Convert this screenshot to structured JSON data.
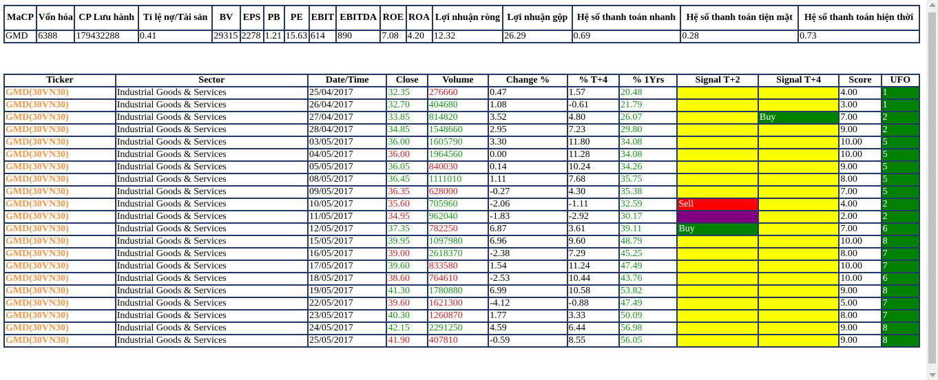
{
  "summary": {
    "headers": [
      "MaCP",
      "Vốn hóa",
      "CP Lưu hành",
      "Tỉ lệ nợ/Tài sản",
      "BV",
      "EPS",
      "PB",
      "PE",
      "EBIT",
      "EBITDA",
      "ROE",
      "ROA",
      "Lợi nhuận ròng",
      "Lợi nhuận gộp",
      "Hệ số thanh toán nhanh",
      "Hệ số thanh toán tiện mặt",
      "Hệ số thanh toán hiện thời"
    ],
    "row": [
      "GMD",
      "6388",
      "179432288",
      "0.41",
      "29315",
      "2278",
      "1.21",
      "15.63",
      "614",
      "890",
      "7.08",
      "4.20",
      "12.32",
      "26.29",
      "0.69",
      "0.28",
      "0.73"
    ]
  },
  "signals": {
    "headers": [
      "Ticker",
      "Sector",
      "Date/Time",
      "Close",
      "Volume",
      "Change %",
      "% T+4",
      "% 1Yrs",
      "Signal T+2",
      "Signal T+4",
      "Score",
      "UFO"
    ],
    "colors": {
      "yellow": "#ffff00",
      "green": "#008000",
      "red": "#ff0000",
      "purple": "#800080",
      "up": "#1a9a1a",
      "down": "#e02020",
      "ticker": "#f79646",
      "border": "#1f3864"
    },
    "rows": [
      {
        "ticker": "GMD(30VN30)",
        "sector": "Industrial Goods & Services",
        "date": "25/04/2017",
        "close": "32.35",
        "close_dir": "up",
        "volume": "276660",
        "volume_dir": "down",
        "change": "0.47",
        "t4": "1.57",
        "y1": "20.48",
        "sig2": "",
        "sig2_color": "yellow",
        "sig4": "",
        "sig4_color": "yellow",
        "score": "4.00",
        "ufo": "1"
      },
      {
        "ticker": "GMD(30VN30)",
        "sector": "Industrial Goods & Services",
        "date": "26/04/2017",
        "close": "32.70",
        "close_dir": "up",
        "volume": "404680",
        "volume_dir": "up",
        "change": "1.08",
        "t4": "-0.61",
        "y1": "21.79",
        "sig2": "",
        "sig2_color": "yellow",
        "sig4": "",
        "sig4_color": "yellow",
        "score": "3.00",
        "ufo": "1"
      },
      {
        "ticker": "GMD(30VN30)",
        "sector": "Industrial Goods & Services",
        "date": "27/04/2017",
        "close": "33.85",
        "close_dir": "up",
        "volume": "814820",
        "volume_dir": "up",
        "change": "3.52",
        "t4": "4.80",
        "y1": "26.07",
        "sig2": "",
        "sig2_color": "yellow",
        "sig4": "Buy",
        "sig4_color": "green",
        "score": "7.00",
        "ufo": "2"
      },
      {
        "ticker": "GMD(30VN30)",
        "sector": "Industrial Goods & Services",
        "date": "28/04/2017",
        "close": "34.85",
        "close_dir": "up",
        "volume": "1548660",
        "volume_dir": "up",
        "change": "2.95",
        "t4": "7.23",
        "y1": "29.80",
        "sig2": "",
        "sig2_color": "yellow",
        "sig4": "",
        "sig4_color": "yellow",
        "score": "9.00",
        "ufo": "2"
      },
      {
        "ticker": "GMD(30VN30)",
        "sector": "Industrial Goods & Services",
        "date": "03/05/2017",
        "close": "36.00",
        "close_dir": "up",
        "volume": "1605790",
        "volume_dir": "up",
        "change": "3.30",
        "t4": "11.80",
        "y1": "34.08",
        "sig2": "",
        "sig2_color": "yellow",
        "sig4": "",
        "sig4_color": "yellow",
        "score": "10.00",
        "ufo": "5"
      },
      {
        "ticker": "GMD(30VN30)",
        "sector": "Industrial Goods & Services",
        "date": "04/05/2017",
        "close": "36.00",
        "close_dir": "down",
        "volume": "1964560",
        "volume_dir": "up",
        "change": "0.00",
        "t4": "11.28",
        "y1": "34.08",
        "sig2": "",
        "sig2_color": "yellow",
        "sig4": "",
        "sig4_color": "yellow",
        "score": "10.00",
        "ufo": "5"
      },
      {
        "ticker": "GMD(30VN30)",
        "sector": "Industrial Goods & Services",
        "date": "05/05/2017",
        "close": "36.05",
        "close_dir": "up",
        "volume": "840030",
        "volume_dir": "down",
        "change": "0.14",
        "t4": "10.24",
        "y1": "34.26",
        "sig2": "",
        "sig2_color": "yellow",
        "sig4": "",
        "sig4_color": "yellow",
        "score": "9.00",
        "ufo": "5"
      },
      {
        "ticker": "GMD(30VN30)",
        "sector": "Industrial Goods & Services",
        "date": "08/05/2017",
        "close": "36.45",
        "close_dir": "up",
        "volume": "1111010",
        "volume_dir": "up",
        "change": "1.11",
        "t4": "7.68",
        "y1": "35.75",
        "sig2": "",
        "sig2_color": "yellow",
        "sig4": "",
        "sig4_color": "yellow",
        "score": "8.00",
        "ufo": "5"
      },
      {
        "ticker": "GMD(30VN30)",
        "sector": "Industrial Goods & Services",
        "date": "09/05/2017",
        "close": "36.35",
        "close_dir": "down",
        "volume": "628000",
        "volume_dir": "down",
        "change": "-0.27",
        "t4": "4.30",
        "y1": "35.38",
        "sig2": "",
        "sig2_color": "yellow",
        "sig4": "",
        "sig4_color": "yellow",
        "score": "7.00",
        "ufo": "5"
      },
      {
        "ticker": "GMD(30VN30)",
        "sector": "Industrial Goods & Services",
        "date": "10/05/2017",
        "close": "35.60",
        "close_dir": "down",
        "volume": "705960",
        "volume_dir": "up",
        "change": "-2.06",
        "t4": "-1.11",
        "y1": "32.59",
        "sig2": "Sell",
        "sig2_color": "red",
        "sig4": "",
        "sig4_color": "yellow",
        "score": "4.00",
        "ufo": "2"
      },
      {
        "ticker": "GMD(30VN30)",
        "sector": "Industrial Goods & Services",
        "date": "11/05/2017",
        "close": "34.95",
        "close_dir": "down",
        "volume": "962040",
        "volume_dir": "up",
        "change": "-1.83",
        "t4": "-2.92",
        "y1": "30.17",
        "sig2": "",
        "sig2_color": "purple",
        "sig4": "",
        "sig4_color": "yellow",
        "score": "2.00",
        "ufo": "2"
      },
      {
        "ticker": "GMD(30VN30)",
        "sector": "Industrial Goods & Services",
        "date": "12/05/2017",
        "close": "37.35",
        "close_dir": "up",
        "volume": "782250",
        "volume_dir": "down",
        "change": "6.87",
        "t4": "3.61",
        "y1": "39.11",
        "sig2": "Buy",
        "sig2_color": "green",
        "sig4": "",
        "sig4_color": "yellow",
        "score": "7.00",
        "ufo": "6"
      },
      {
        "ticker": "GMD(30VN30)",
        "sector": "Industrial Goods & Services",
        "date": "15/05/2017",
        "close": "39.95",
        "close_dir": "up",
        "volume": "1097980",
        "volume_dir": "up",
        "change": "6.96",
        "t4": "9.60",
        "y1": "48.79",
        "sig2": "",
        "sig2_color": "yellow",
        "sig4": "",
        "sig4_color": "yellow",
        "score": "10.00",
        "ufo": "8"
      },
      {
        "ticker": "GMD(30VN30)",
        "sector": "Industrial Goods & Services",
        "date": "16/05/2017",
        "close": "39.00",
        "close_dir": "down",
        "volume": "2618370",
        "volume_dir": "up",
        "change": "-2.38",
        "t4": "7.29",
        "y1": "45.25",
        "sig2": "",
        "sig2_color": "yellow",
        "sig4": "",
        "sig4_color": "yellow",
        "score": "8.00",
        "ufo": "7"
      },
      {
        "ticker": "GMD(30VN30)",
        "sector": "Industrial Goods & Services",
        "date": "17/05/2017",
        "close": "39.60",
        "close_dir": "up",
        "volume": "833580",
        "volume_dir": "down",
        "change": "1.54",
        "t4": "11.24",
        "y1": "47.49",
        "sig2": "",
        "sig2_color": "yellow",
        "sig4": "",
        "sig4_color": "yellow",
        "score": "10.00",
        "ufo": "7"
      },
      {
        "ticker": "GMD(30VN30)",
        "sector": "Industrial Goods & Services",
        "date": "18/05/2017",
        "close": "38.60",
        "close_dir": "down",
        "volume": "764610",
        "volume_dir": "down",
        "change": "-2.53",
        "t4": "10.44",
        "y1": "43.76",
        "sig2": "",
        "sig2_color": "yellow",
        "sig4": "",
        "sig4_color": "yellow",
        "score": "10.00",
        "ufo": "6"
      },
      {
        "ticker": "GMD(30VN30)",
        "sector": "Industrial Goods & Services",
        "date": "19/05/2017",
        "close": "41.30",
        "close_dir": "up",
        "volume": "1780880",
        "volume_dir": "up",
        "change": "6.99",
        "t4": "10.58",
        "y1": "53.82",
        "sig2": "",
        "sig2_color": "yellow",
        "sig4": "",
        "sig4_color": "yellow",
        "score": "9.00",
        "ufo": "8"
      },
      {
        "ticker": "GMD(30VN30)",
        "sector": "Industrial Goods & Services",
        "date": "22/05/2017",
        "close": "39.60",
        "close_dir": "down",
        "volume": "1621300",
        "volume_dir": "down",
        "change": "-4.12",
        "t4": "-0.88",
        "y1": "47.49",
        "sig2": "",
        "sig2_color": "yellow",
        "sig4": "",
        "sig4_color": "yellow",
        "score": "5.00",
        "ufo": "7"
      },
      {
        "ticker": "GMD(30VN30)",
        "sector": "Industrial Goods & Services",
        "date": "23/05/2017",
        "close": "40.30",
        "close_dir": "up",
        "volume": "1260870",
        "volume_dir": "down",
        "change": "1.77",
        "t4": "3.33",
        "y1": "50.09",
        "sig2": "",
        "sig2_color": "yellow",
        "sig4": "",
        "sig4_color": "yellow",
        "score": "8.00",
        "ufo": "7"
      },
      {
        "ticker": "GMD(30VN30)",
        "sector": "Industrial Goods & Services",
        "date": "24/05/2017",
        "close": "42.15",
        "close_dir": "up",
        "volume": "2291250",
        "volume_dir": "up",
        "change": "4.59",
        "t4": "6.44",
        "y1": "56.98",
        "sig2": "",
        "sig2_color": "yellow",
        "sig4": "",
        "sig4_color": "yellow",
        "score": "9.00",
        "ufo": "8"
      },
      {
        "ticker": "GMD(30VN30)",
        "sector": "Industrial Goods & Services",
        "date": "25/05/2017",
        "close": "41.90",
        "close_dir": "down",
        "volume": "407810",
        "volume_dir": "down",
        "change": "-0.59",
        "t4": "8.55",
        "y1": "56.05",
        "sig2": "",
        "sig2_color": "yellow",
        "sig4": "",
        "sig4_color": "yellow",
        "score": "9.00",
        "ufo": "8"
      }
    ]
  }
}
